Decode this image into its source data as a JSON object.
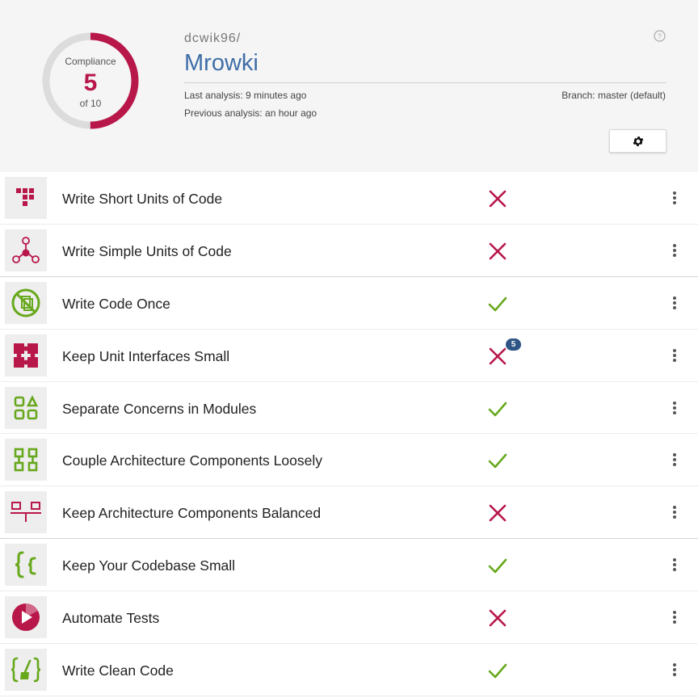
{
  "colors": {
    "red": "#b8174a",
    "green": "#67a81c",
    "blue": "#3f6ea8",
    "badge": "#2e5585"
  },
  "compliance": {
    "title": "Compliance",
    "score": "5",
    "of_label": "of 10",
    "value": 5,
    "max": 10
  },
  "repo": {
    "owner": "dcwik96/",
    "name": "Mrowki"
  },
  "analysis": {
    "last": "Last analysis: 9 minutes ago",
    "previous": "Previous analysis: an hour ago",
    "branch": "Branch: master (default)"
  },
  "icons": {
    "help": "help-circle-icon",
    "settings": "gear-icon",
    "more": "vertical-dots-icon"
  },
  "guidelines": [
    {
      "label": "Write Short Units of Code",
      "icon": "short-units-icon",
      "passed": false,
      "badge": ""
    },
    {
      "label": "Write Simple Units of Code",
      "icon": "simple-units-icon",
      "passed": false,
      "badge": ""
    },
    {
      "label": "Write Code Once",
      "icon": "no-duplication-icon",
      "passed": true,
      "badge": ""
    },
    {
      "label": "Keep Unit Interfaces Small",
      "icon": "puzzle-icon",
      "passed": false,
      "badge": "5"
    },
    {
      "label": "Separate Concerns in Modules",
      "icon": "modules-icon",
      "passed": true,
      "badge": ""
    },
    {
      "label": "Couple Architecture Components Loosely",
      "icon": "components-icon",
      "passed": true,
      "badge": ""
    },
    {
      "label": "Keep Architecture Components Balanced",
      "icon": "balance-icon",
      "passed": false,
      "badge": ""
    },
    {
      "label": "Keep Your Codebase Small",
      "icon": "braces-icon",
      "passed": true,
      "badge": ""
    },
    {
      "label": "Automate Tests",
      "icon": "play-test-icon",
      "passed": false,
      "badge": ""
    },
    {
      "label": "Write Clean Code",
      "icon": "clean-code-icon",
      "passed": true,
      "badge": ""
    }
  ]
}
